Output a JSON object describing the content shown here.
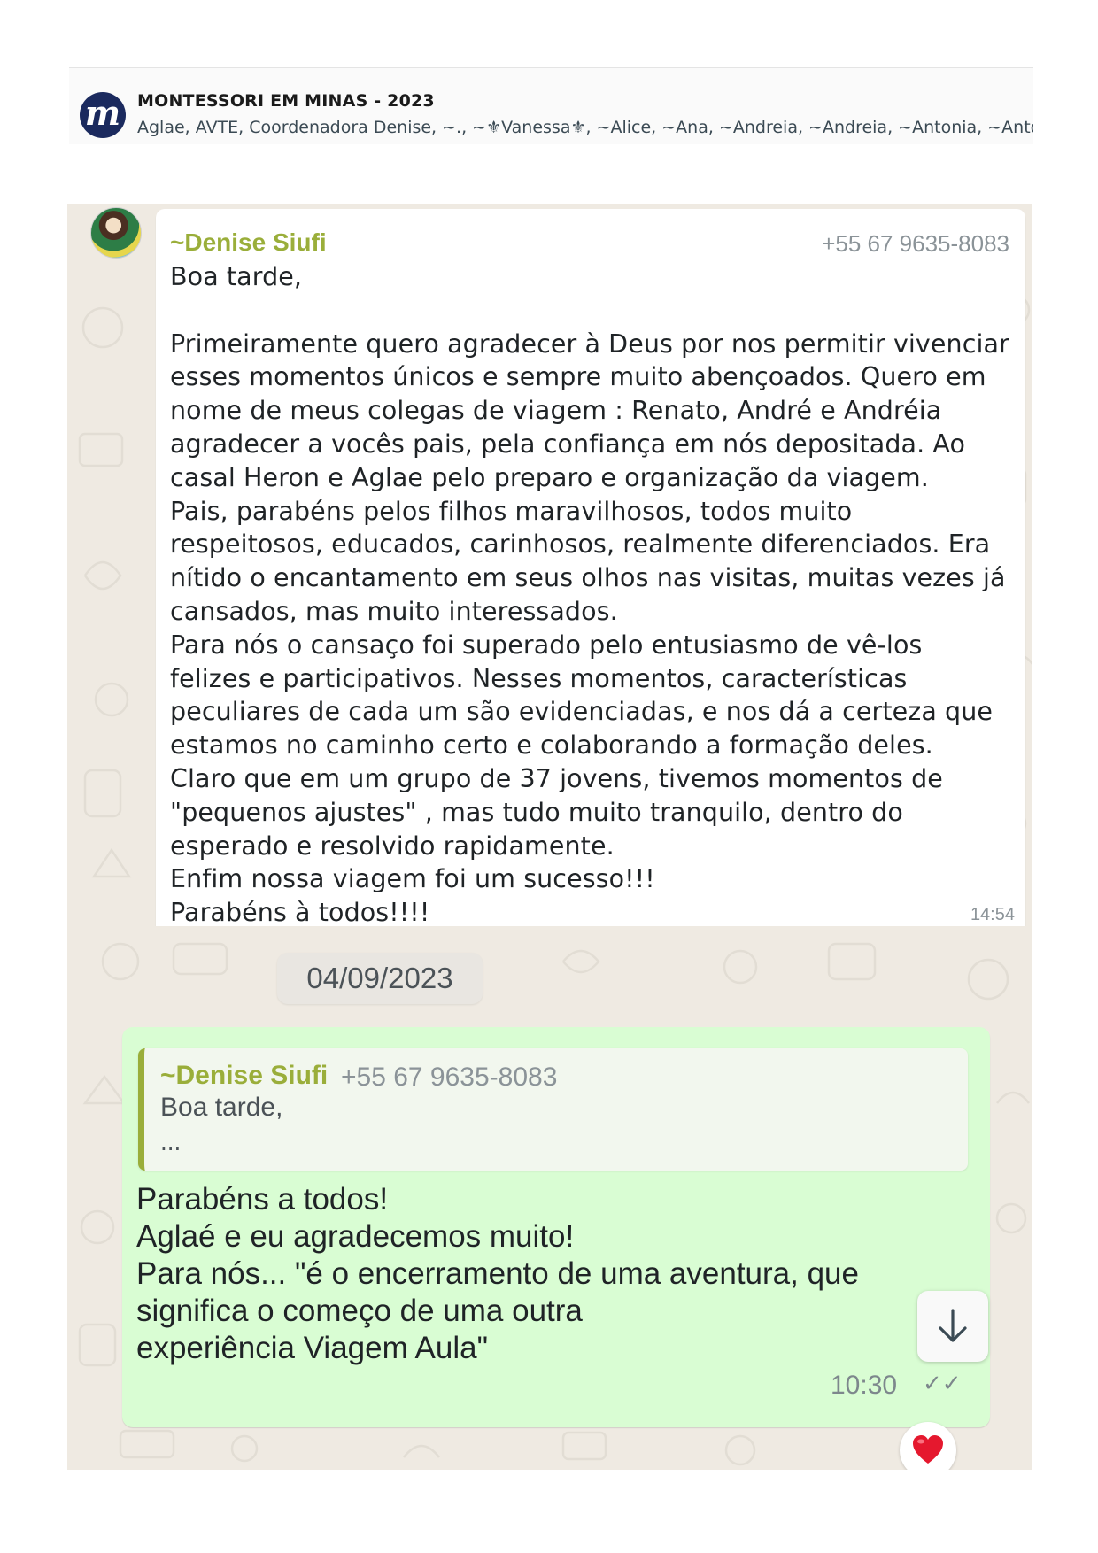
{
  "header": {
    "logo_letter": "m",
    "group_name": "MONTESSORI EM MINAS - 2023",
    "members": "Aglae, AVTE, Coordenadora Denise, ~., ~⚜Vanessa⚜, ~Alice, ~Ana, ~Andreia, ~Andreia, ~Antonia, ~Antonia"
  },
  "messages": [
    {
      "sender": "~Denise Siufi",
      "phone": "+55 67 9635-8083",
      "text": "Boa tarde,\n\nPrimeiramente quero agradecer à Deus por nos permitir vivenciar\nesses momentos únicos e sempre muito abençoados. Quero em\nnome de meus colegas de viagem : Renato, André e Andréia\nagradecer a vocês pais, pela confiança em nós depositada. Ao\ncasal Heron e Aglae pelo preparo e organização da viagem.\nPais, parabéns pelos filhos maravilhosos, todos muito\nrespeitosos, educados, carinhosos, realmente diferenciados. Era\nnítido o encantamento em seus olhos nas visitas, muitas vezes já\ncansados, mas muito interessados.\nPara nós o cansaço foi superado pelo entusiasmo de vê-los\nfelizes e participativos. Nesses momentos, características\npeculiares de cada um são evidenciadas, e nos dá a certeza que\nestamos no caminho certo e colaborando a formação deles.\nClaro que em um grupo de 37 jovens, tivemos momentos de\n\"pequenos ajustes\" , mas tudo muito tranquilo, dentro do\nesperado e resolvido rapidamente.\nEnfim nossa viagem foi um sucesso!!!\nParabéns à todos!!!!",
      "time": "14:54"
    },
    {
      "quote": {
        "sender": "~Denise Siufi",
        "phone": "+55 67 9635-8083",
        "text": "Boa tarde,",
        "ellipsis": "..."
      },
      "text": "Parabéns a todos!\nAglaé e eu agradecemos muito!\nPara nós... \"é o encerramento de uma aventura, que\nsignifica o começo de uma outra\nexperiência Viagem Aula\"",
      "time": "10:30",
      "status": "read-ticks",
      "reaction": "heart"
    }
  ],
  "date_separator": "04/09/2023",
  "colors": {
    "sender_name": "#9aae3a",
    "outgoing_bubble": "#d9fdd3",
    "chat_background": "#efeae2",
    "logo": "#1b2a5e"
  }
}
